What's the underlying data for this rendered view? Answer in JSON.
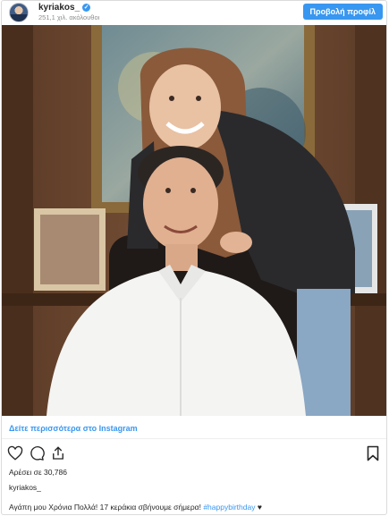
{
  "header": {
    "username": "kyriakos_",
    "followers": "251,1 χιλ. ακόλουθοι",
    "view_profile_label": "Προβολή προφίλ"
  },
  "post": {
    "more_link": "Δείτε περισσότερα στο Instagram",
    "likes": "Αρέσει σε 30,786",
    "username": "kyriakos_",
    "caption_text": "Αγάπη μου Χρόνια Πολλά! 17 κεράκια σβήνουμε σήμερα! ",
    "caption_hashtag": "#happybirthday",
    "caption_emoji": "♥"
  },
  "icons": [
    "verified-badge-icon",
    "heart-icon",
    "comment-icon",
    "share-icon",
    "bookmark-icon"
  ],
  "colors": {
    "accent": "#3897f0",
    "muted": "#8e8e8e",
    "text": "#262626"
  }
}
